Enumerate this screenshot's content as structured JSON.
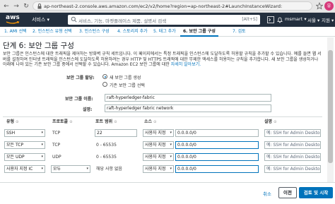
{
  "browser": {
    "url": "ap-northeast-2.console.aws.amazon.com/ec2/v2/home?region=ap-northeast-2#LaunchInstanceWizard:",
    "avatar_letter": "유"
  },
  "aws_nav": {
    "logo_text": "aws",
    "services_label": "서비스 ▾",
    "search_placeholder": "서비스, 기능, 마켓플레이스 제품, 설명서 검색",
    "search_shortcut": "[Alt+S]",
    "user_label": "msmart ▾",
    "region_label": "서울 ▾",
    "support_label": "지원 ▾"
  },
  "wizard_tabs": [
    {
      "label": "1. AMI 선택"
    },
    {
      "label": "2. 인스턴스 유형 선택"
    },
    {
      "label": "3. 인스턴스 구성"
    },
    {
      "label": "4. 스토리지 추가"
    },
    {
      "label": "5. 태그 추가"
    },
    {
      "label": "6. 보안 그룹 구성"
    },
    {
      "label": "7. 검토"
    }
  ],
  "step": {
    "title": "단계 6: 보안 그룹 구성",
    "description": "보안 그룹은 인스턴스에 대한 트래픽을 제어하는 방화벽 규칙 세트입니다. 이 페이지에서는 특정 트래픽을 인스턴스에 도달하도록 허용할 규칙을 추가할 수 있습니다. 예를 들면 웹 서버를 설정하여 인터넷 트래픽을 인스턴스에 도달하도록 허용하려는 경우 HTTP 및 HTTPS 트래픽에 대한 무제한 액세스를 허용하는 규칙을 추가합니다. 새 보안 그룹을 생성하거나 아래에 나와 있는 기존 보안 그룹 중에서 선택할 수 있습니다. Amazon EC2 보안 그룹에 대한 ",
    "learn_more_link": "자세히 알아보기."
  },
  "form": {
    "assign_label": "보안 그룹 할당:",
    "radio_new": "새 보안 그룹 생성",
    "radio_existing": "기존 보안 그룹 선택",
    "name_label": "보안 그룹 이름:",
    "name_value": "raft-hyperledger-fabric",
    "desc_label": "설명:",
    "desc_value": "raft-hyperledger fabric network"
  },
  "table": {
    "headers": [
      "유형",
      "프로토콜",
      "포트 범위",
      "소스",
      "설명"
    ],
    "rows": [
      {
        "type": "SSH",
        "protocol": "TCP",
        "port": "22",
        "source": "사용자 지정",
        "cidr": "0.0.0.0/0",
        "desc": "예: SSH for Admin Desktop"
      },
      {
        "type": "모든 TCP",
        "protocol": "TCP",
        "port": "0 - 65535",
        "source": "사용자 지정",
        "cidr": "0.0.0.0/0",
        "desc": "예: SSH for Admin Desktop"
      },
      {
        "type": "모든 UDP",
        "protocol": "UDP",
        "port": "0 - 65535",
        "source": "사용자 지정",
        "cidr": "0.0.0.0/0",
        "desc": "예: SSH for Admin Desktop"
      },
      {
        "type": "사용자 지정 IC",
        "protocol": "모두",
        "port": "해당 사항 없음",
        "source": "사용자 지정",
        "cidr": "0.0.0.0/0",
        "desc": "예: SSH for Admin Desktop"
      }
    ]
  },
  "footer": {
    "cancel": "취소",
    "previous": "이전",
    "review_launch": "검토 및 시작"
  }
}
